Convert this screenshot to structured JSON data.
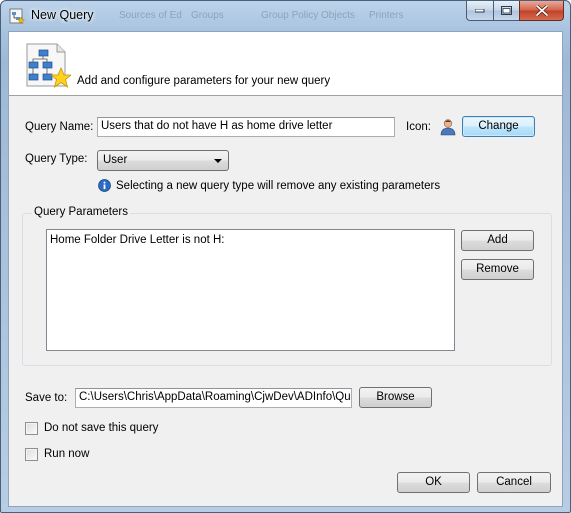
{
  "window": {
    "title": "New Query",
    "icon": "query-window-icon",
    "background_ghosts": [
      "Sources of Ed",
      "Groups",
      "Group Policy Objects",
      "Printers"
    ]
  },
  "header": {
    "icon": "query-wizard-icon",
    "text": "Add and configure parameters for your new query"
  },
  "form": {
    "query_name_label": "Query Name:",
    "query_name_value": "Users that do not have H as home drive letter",
    "icon_label": "Icon:",
    "icon_image": "user-icon",
    "change_label": "Change",
    "query_type_label": "Query Type:",
    "query_type_value": "User",
    "info_text": "Selecting a new query type will remove any existing parameters"
  },
  "parameters": {
    "group_title": "Query Parameters",
    "items": [
      "Home Folder Drive Letter is not H:"
    ],
    "add_label": "Add",
    "remove_label": "Remove"
  },
  "save": {
    "label": "Save to:",
    "path": "C:\\Users\\Chris\\AppData\\Roaming\\CjwDev\\ADInfo\\Quer",
    "browse_label": "Browse"
  },
  "options": {
    "do_not_save_label": "Do not save this query",
    "do_not_save_checked": false,
    "run_now_label": "Run now",
    "run_now_checked": false
  },
  "footer": {
    "ok_label": "OK",
    "cancel_label": "Cancel"
  },
  "colors": {
    "focus_border": "#3c7fb1",
    "info_icon": "#2a6cc3"
  }
}
